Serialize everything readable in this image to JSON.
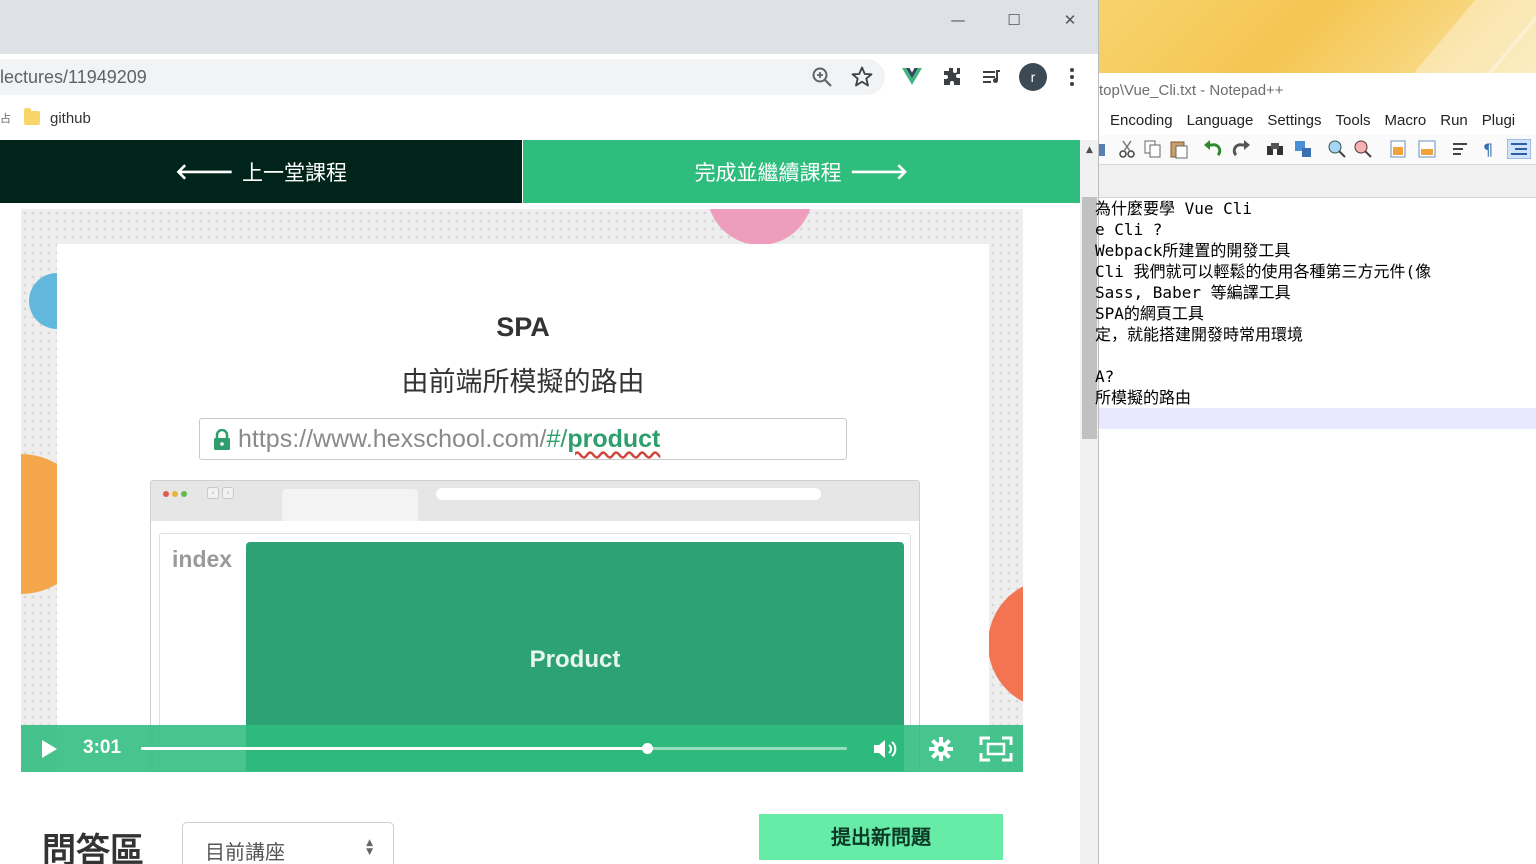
{
  "browser": {
    "window_controls": {
      "minimize": "—",
      "maximize": "☐",
      "close": "✕"
    },
    "url": "lectures/11949209",
    "avatar_letter": "r",
    "bookmarks": [
      {
        "label": "github"
      }
    ],
    "bookmark_left_glyph": "占"
  },
  "page": {
    "nav": {
      "prev_label": "上一堂課程",
      "next_label": "完成並繼續課程"
    },
    "video": {
      "slide_title": "SPA",
      "slide_subtitle": "由前端所模擬的路由",
      "demo_url_base": "https://www.hexschool.com/",
      "demo_url_hash": "#/",
      "demo_url_path": "product",
      "mock_index_label": "index",
      "mock_product_label": "Product",
      "current_time": "3:01",
      "progress": 0.717,
      "accent_color": "#2fbd7e"
    },
    "qa": {
      "title": "問答區",
      "select_value": "目前講座",
      "new_question_button": "提出新問題"
    }
  },
  "notepad": {
    "title": "top\\Vue_Cli.txt - Notepad++",
    "menu": [
      "Encoding",
      "Language",
      "Settings",
      "Tools",
      "Macro",
      "Run",
      "Plugi"
    ],
    "lines": [
      "為什麼要學 Vue Cli",
      "e Cli ?",
      "Webpack所建置的開發工具",
      "Cli 我們就可以輕鬆的使用各種第三方元件(像",
      "Sass, Baber 等編譯工具",
      "SPA的網頁工具",
      "定，就能搭建開發時常用環境",
      "",
      "A?",
      "所模擬的路由",
      ""
    ]
  }
}
